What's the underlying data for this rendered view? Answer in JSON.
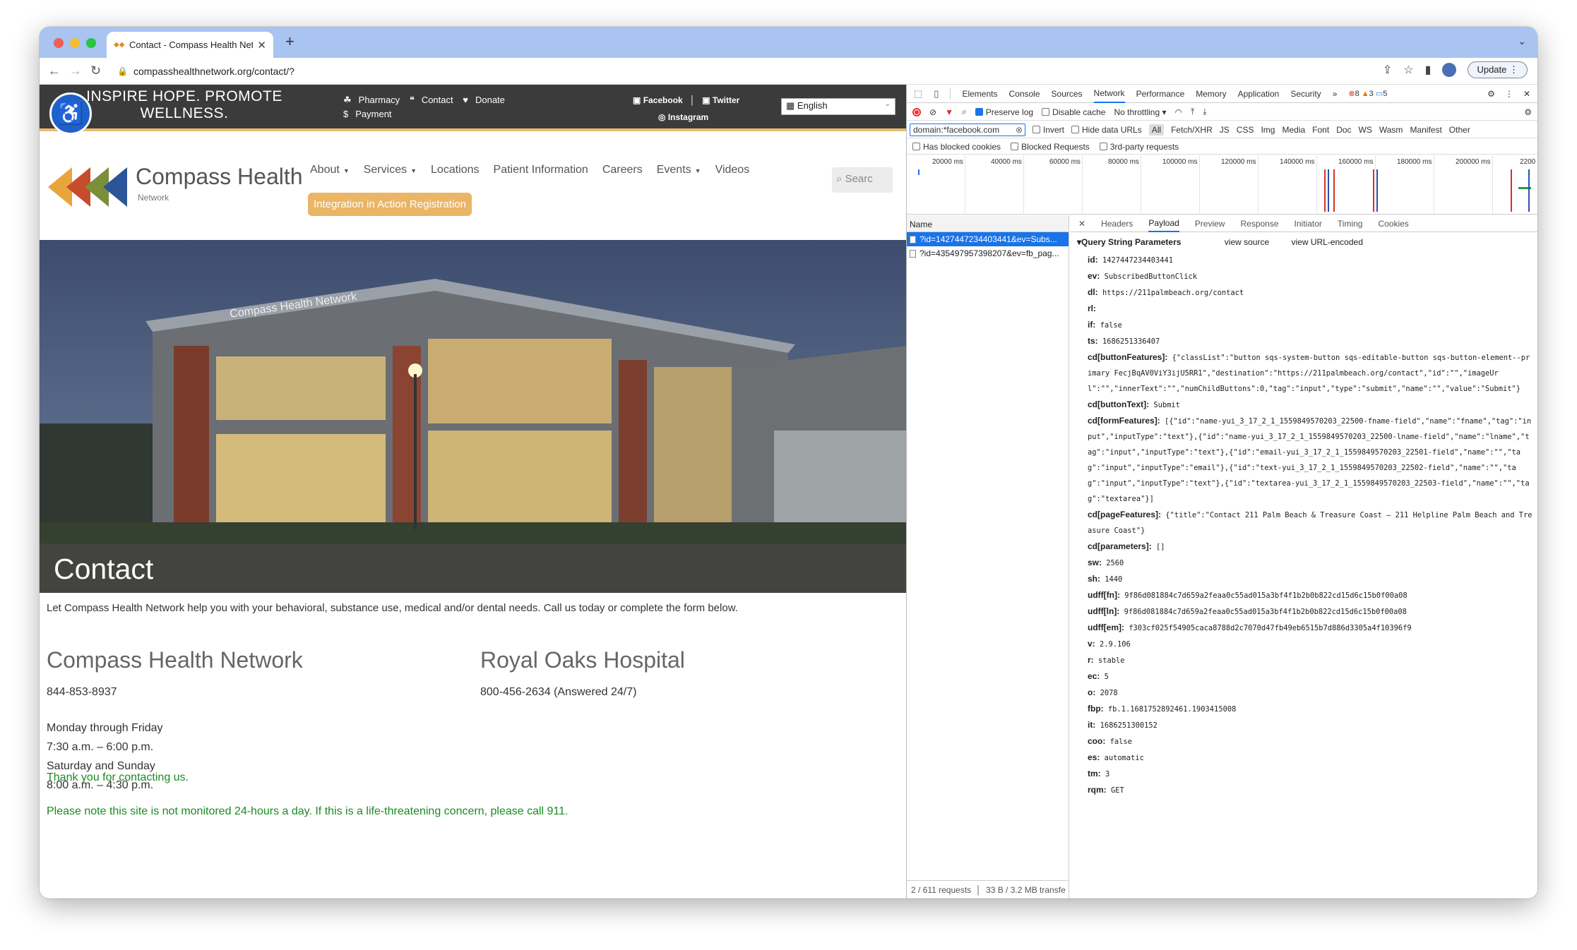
{
  "browser": {
    "tab_title": "Contact - Compass Health Net",
    "url": "compasshealthnetwork.org/contact/?",
    "update_label": "Update"
  },
  "site": {
    "slogan_line1": "INSPIRE HOPE. PROMOTE",
    "slogan_line2": "WELLNESS.",
    "top_links": {
      "pharmacy": "Pharmacy",
      "contact": "Contact",
      "donate": "Donate",
      "payment": "Payment"
    },
    "social": {
      "facebook": "Facebook",
      "twitter": "Twitter",
      "instagram": "Instagram"
    },
    "language": "English",
    "logo": {
      "name": "Compass Health",
      "sub": "Network"
    },
    "nav": [
      "About",
      "Services",
      "Locations",
      "Patient Information",
      "Careers",
      "Events",
      "Videos"
    ],
    "register_button": "Integration in Action Registration",
    "search_placeholder": "Searc",
    "hero_title": "Contact",
    "intro": "Let Compass Health Network help you with your behavioral, substance use, medical and/or dental needs. Call us today or complete the form below.",
    "col1": {
      "heading": "Compass Health Network",
      "phone": "844-853-8937",
      "hours1": "Monday through Friday",
      "hours2": "7:30 a.m. – 6:00 p.m.",
      "hours3": "Saturday and Sunday",
      "hours4": "8:00 a.m. – 4:30 p.m."
    },
    "col2": {
      "heading": "Royal Oaks Hospital",
      "phone": "800-456-2634 (Answered 24/7)"
    },
    "thanks": "Thank you for contacting us.",
    "notice": "Please note this site is not monitored 24-hours a day. If this is a life-threatening concern, please call 911."
  },
  "devtools": {
    "tabs": [
      "Elements",
      "Console",
      "Sources",
      "Network",
      "Performance",
      "Memory",
      "Application",
      "Security"
    ],
    "active_tab": "Network",
    "errors": "8",
    "warnings": "3",
    "messages": "5",
    "preserve_log": "Preserve log",
    "disable_cache": "Disable cache",
    "throttling": "No throttling",
    "filter_value": "domain:*facebook.com",
    "invert": "Invert",
    "hide_data_urls": "Hide data URLs",
    "types": [
      "All",
      "Fetch/XHR",
      "JS",
      "CSS",
      "Img",
      "Media",
      "Font",
      "Doc",
      "WS",
      "Wasm",
      "Manifest",
      "Other"
    ],
    "has_blocked_cookies": "Has blocked cookies",
    "blocked_requests": "Blocked Requests",
    "third_party": "3rd-party requests",
    "timeline_labels": [
      "20000 ms",
      "40000 ms",
      "60000 ms",
      "80000 ms",
      "100000 ms",
      "120000 ms",
      "140000 ms",
      "160000 ms",
      "180000 ms",
      "200000 ms",
      "2200"
    ],
    "name_header": "Name",
    "requests": [
      "?id=1427447234403441&ev=Subs...",
      "?id=435497957398207&ev=fb_pag..."
    ],
    "status": "2 / 611 requests",
    "transfer": "33 B / 3.2 MB transfe",
    "detail_tabs": [
      "Headers",
      "Payload",
      "Preview",
      "Response",
      "Initiator",
      "Timing",
      "Cookies"
    ],
    "active_detail_tab": "Payload",
    "qs_title": "Query String Parameters",
    "view_source": "view source",
    "view_url_encoded": "view URL-encoded",
    "params": [
      {
        "k": "id:",
        "v": "1427447234403441"
      },
      {
        "k": "ev:",
        "v": "SubscribedButtonClick"
      },
      {
        "k": "dl:",
        "v": "https://211palmbeach.org/contact"
      },
      {
        "k": "rl:",
        "v": ""
      },
      {
        "k": "if:",
        "v": "false"
      },
      {
        "k": "ts:",
        "v": "1686251336407"
      },
      {
        "k": "cd[buttonFeatures]:",
        "v": "{\"classList\":\"button sqs-system-button sqs-editable-button sqs-button-element--primary FecjBqAV0ViY3ijU5RR1\",\"destination\":\"https://211palmbeach.org/contact\",\"id\":\"\",\"imageUrl\":\"\",\"innerText\":\"\",\"numChildButtons\":0,\"tag\":\"input\",\"type\":\"submit\",\"name\":\"\",\"value\":\"Submit\"}"
      },
      {
        "k": "cd[buttonText]:",
        "v": "Submit"
      },
      {
        "k": "cd[formFeatures]:",
        "v": "[{\"id\":\"name-yui_3_17_2_1_1559849570203_22500-fname-field\",\"name\":\"fname\",\"tag\":\"input\",\"inputType\":\"text\"},{\"id\":\"name-yui_3_17_2_1_1559849570203_22500-lname-field\",\"name\":\"lname\",\"tag\":\"input\",\"inputType\":\"text\"},{\"id\":\"email-yui_3_17_2_1_1559849570203_22501-field\",\"name\":\"\",\"tag\":\"input\",\"inputType\":\"email\"},{\"id\":\"text-yui_3_17_2_1_1559849570203_22502-field\",\"name\":\"\",\"tag\":\"input\",\"inputType\":\"text\"},{\"id\":\"textarea-yui_3_17_2_1_1559849570203_22503-field\",\"name\":\"\",\"tag\":\"textarea\"}]"
      },
      {
        "k": "cd[pageFeatures]:",
        "v": "{\"title\":\"Contact 211 Palm Beach & Treasure Coast – 211 Helpline Palm Beach and Treasure Coast\"}"
      },
      {
        "k": "cd[parameters]:",
        "v": "[]"
      },
      {
        "k": "sw:",
        "v": "2560"
      },
      {
        "k": "sh:",
        "v": "1440"
      },
      {
        "k": "udff[fn]:",
        "v": "9f86d081884c7d659a2feaa0c55ad015a3bf4f1b2b0b822cd15d6c15b0f00a08"
      },
      {
        "k": "udff[ln]:",
        "v": "9f86d081884c7d659a2feaa0c55ad015a3bf4f1b2b0b822cd15d6c15b0f00a08"
      },
      {
        "k": "udff[em]:",
        "v": "f303cf025f54905caca8788d2c7070d47fb49eb6515b7d886d3305a4f10396f9"
      },
      {
        "k": "v:",
        "v": "2.9.106"
      },
      {
        "k": "r:",
        "v": "stable"
      },
      {
        "k": "ec:",
        "v": "5"
      },
      {
        "k": "o:",
        "v": "2078"
      },
      {
        "k": "fbp:",
        "v": "fb.1.1681752892461.1903415008"
      },
      {
        "k": "it:",
        "v": "1686251300152"
      },
      {
        "k": "coo:",
        "v": "false"
      },
      {
        "k": "es:",
        "v": "automatic"
      },
      {
        "k": "tm:",
        "v": "3"
      },
      {
        "k": "rqm:",
        "v": "GET"
      }
    ]
  }
}
